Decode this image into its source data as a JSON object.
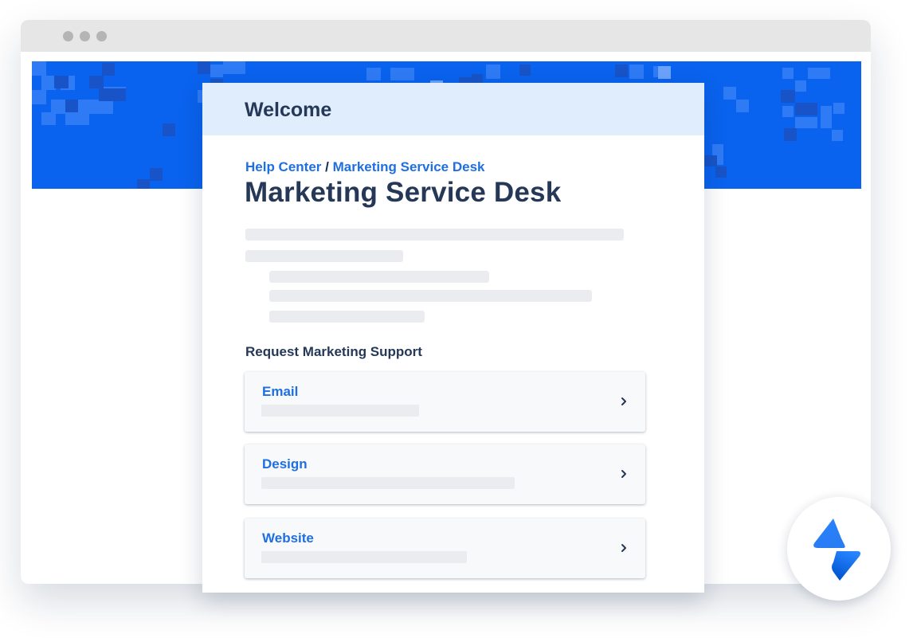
{
  "browser": {
    "window_controls": [
      "dot",
      "dot",
      "dot"
    ]
  },
  "portal": {
    "header_title": "Welcome",
    "breadcrumb": {
      "home": "Help Center",
      "separator": "/",
      "current": "Marketing Service Desk"
    },
    "title": "Marketing Service Desk",
    "section_title": "Request Marketing Support",
    "request_types": [
      {
        "label": "Email",
        "icon": "chevron-right-icon"
      },
      {
        "label": "Design",
        "icon": "chevron-right-icon"
      },
      {
        "label": "Website",
        "icon": "chevron-right-icon"
      }
    ]
  },
  "colors": {
    "banner": "#0a63ee",
    "header_bg": "#e0edfd",
    "link": "#1f6fe0",
    "heading": "#253858",
    "skeleton": "#ebecf0"
  },
  "logo": {
    "icon": "jira-service-desk-logo-icon"
  }
}
